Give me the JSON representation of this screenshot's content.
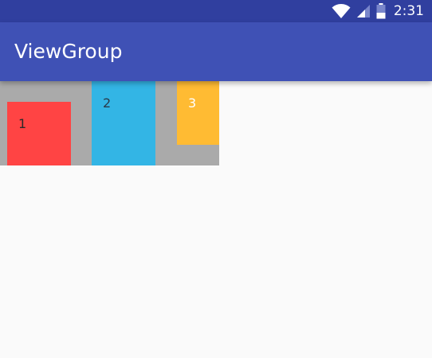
{
  "status_bar": {
    "time": "2:31",
    "icons": [
      "wifi-icon",
      "cell-signal-icon",
      "battery-icon"
    ],
    "color": "#303f9f"
  },
  "toolbar": {
    "title": "ViewGroup",
    "color": "#3f51b5"
  },
  "view_group": {
    "background": "#aaaaaa",
    "children": [
      {
        "label": "1",
        "color": "#ff4444"
      },
      {
        "label": "2",
        "color": "#33b5e5"
      },
      {
        "label": "3",
        "color": "#ffbb33"
      }
    ]
  }
}
